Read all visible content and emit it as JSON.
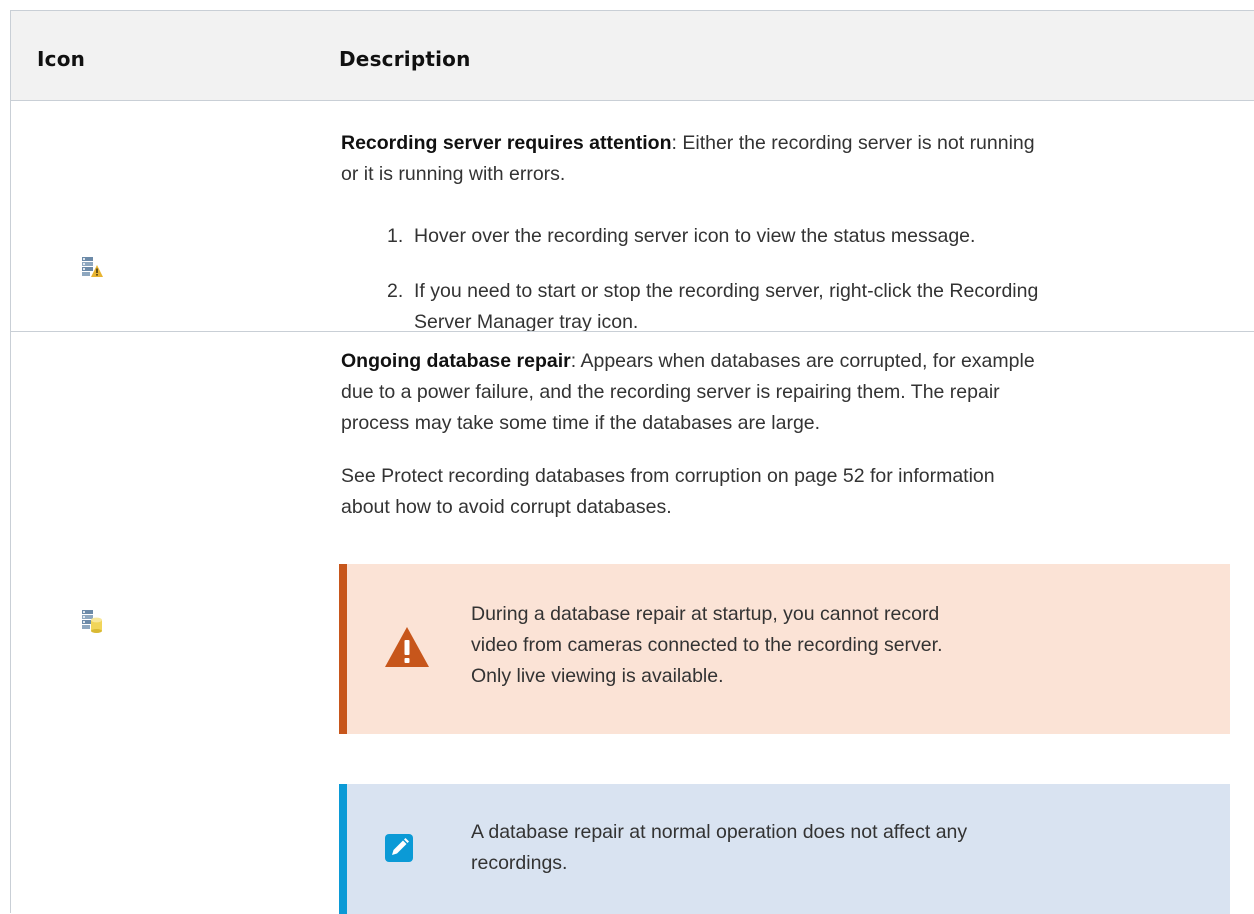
{
  "header": {
    "icon_label": "Icon",
    "description_label": "Description"
  },
  "rows": [
    {
      "icon": "recording-server-attention-icon",
      "title": "Recording server requires attention",
      "line1": ": Either the recording server is not running",
      "line2": "or it is running with errors.",
      "steps": [
        {
          "num": "1.",
          "line1": "Hover over the recording server icon to view the status message."
        },
        {
          "num": "2.",
          "line1": "If you need to start or stop the recording server, right-click the Recording",
          "line2": "Server Manager tray icon."
        }
      ]
    },
    {
      "icon": "database-repair-icon",
      "title": "Ongoing database repair",
      "p1_line1": ": Appears when databases are corrupted, for example",
      "p1_line2": "due to a power failure, and the recording server is repairing them. The repair",
      "p1_line3": "process may take some time if the databases are large.",
      "p2_line1": "See Protect recording databases from corruption on page 52 for information",
      "p2_line2": "about how to avoid corrupt databases.",
      "warning": {
        "icon": "warning-icon",
        "line1": "During a database repair at startup, you cannot record",
        "line2": "video from cameras connected to the recording server.",
        "line3": "Only live viewing is available."
      },
      "note": {
        "icon": "pencil-note-icon",
        "line1": "A database repair at normal operation does not affect any",
        "line2": "recordings."
      }
    }
  ],
  "colors": {
    "warning_accent": "#c7561b",
    "warning_bg": "#fbe3d6",
    "note_accent": "#0b9ad6",
    "note_bg": "#d9e3f1"
  }
}
